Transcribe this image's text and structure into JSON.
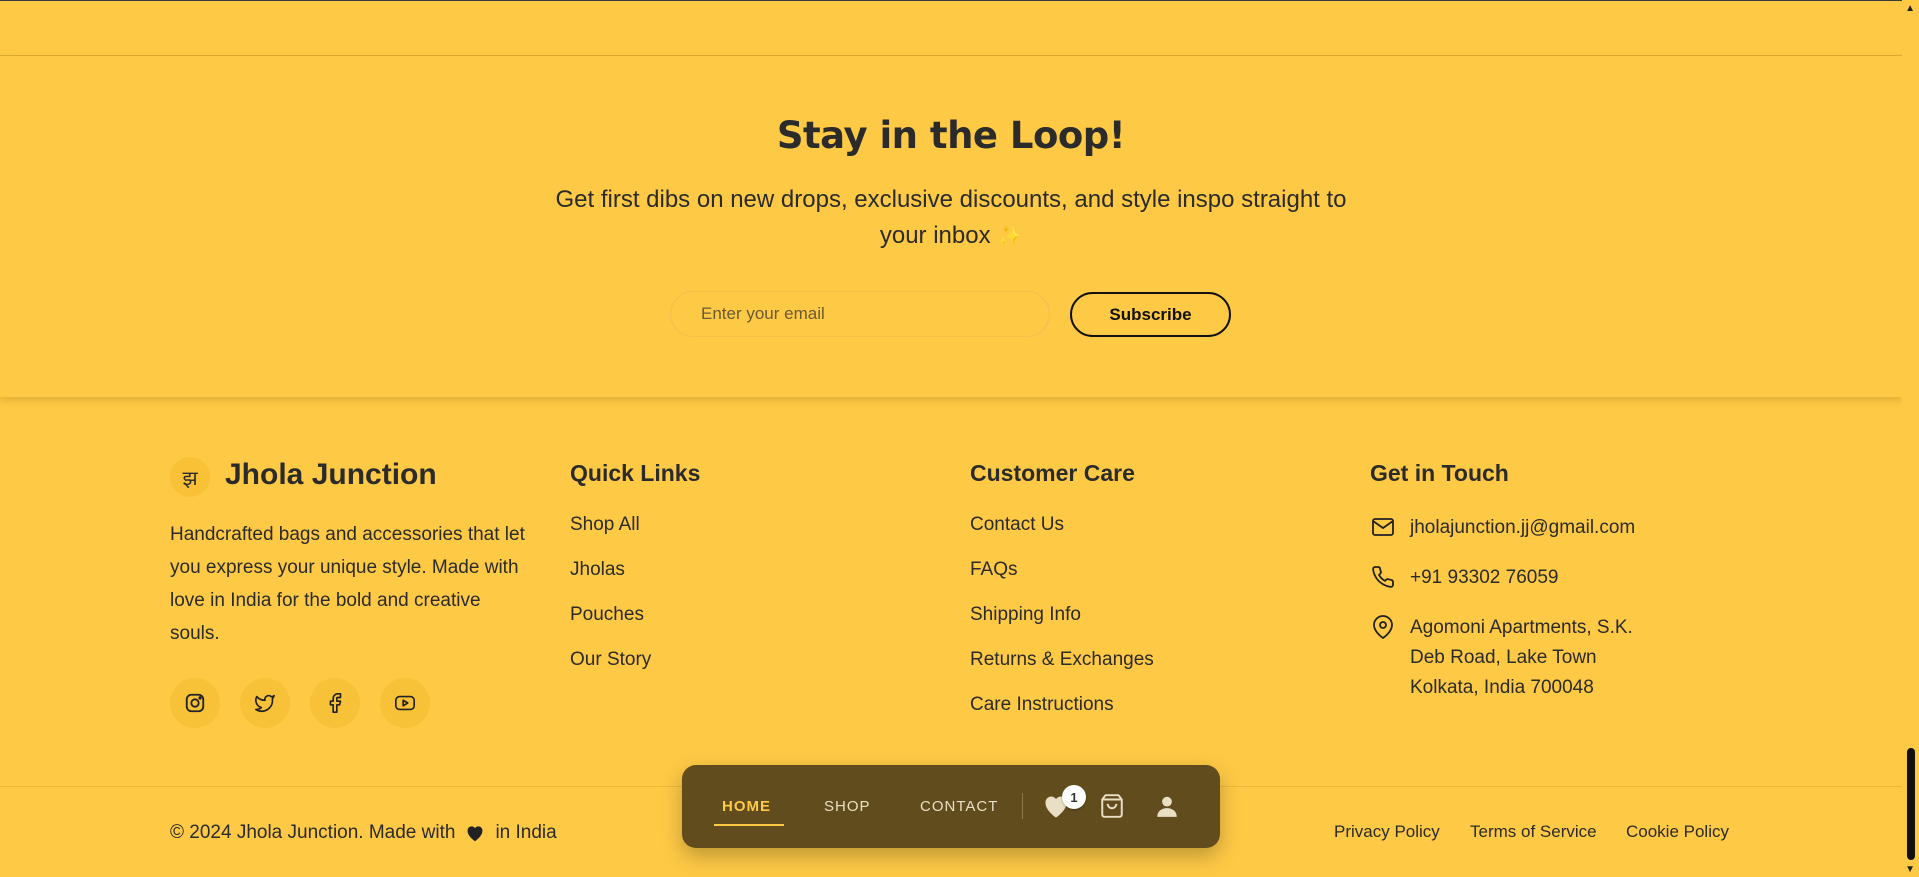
{
  "newsletter": {
    "title": "Stay in the Loop!",
    "subtitle": "Get first dibs on new drops, exclusive discounts, and style inspo straight to your inbox",
    "sparkle": "✨",
    "email_placeholder": "Enter your email",
    "subscribe_label": "Subscribe"
  },
  "brand": {
    "logo_glyph": "झ",
    "name": "Jhola Junction",
    "description": "Handcrafted bags and accessories that let you express your unique style. Made with love in India for the bold and creative souls.",
    "socials": [
      "instagram-icon",
      "twitter-icon",
      "facebook-icon",
      "youtube-icon"
    ]
  },
  "quick_links": {
    "title": "Quick Links",
    "items": [
      "Shop All",
      "Jholas",
      "Pouches",
      "Our Story"
    ]
  },
  "customer_care": {
    "title": "Customer Care",
    "items": [
      "Contact Us",
      "FAQs",
      "Shipping Info",
      "Returns & Exchanges",
      "Care Instructions"
    ]
  },
  "contact": {
    "title": "Get in Touch",
    "email": "jholajunction.jj@gmail.com",
    "phone": "+91 93302 76059",
    "address": "Agomoni Apartments, S.K. Deb Road, Lake Town Kolkata, India 700048"
  },
  "bottom": {
    "copyright_prefix": "© 2024 Jhola Junction. Made with",
    "copyright_suffix": "in India",
    "legal": [
      "Privacy Policy",
      "Terms of Service",
      "Cookie Policy"
    ]
  },
  "nav": {
    "items": [
      "HOME",
      "SHOP",
      "CONTACT"
    ],
    "active": "HOME",
    "wishlist_count": "1"
  },
  "colors": {
    "background": "#FEC945",
    "nav_bg": "#614C1D",
    "text": "#2B2B2B"
  }
}
